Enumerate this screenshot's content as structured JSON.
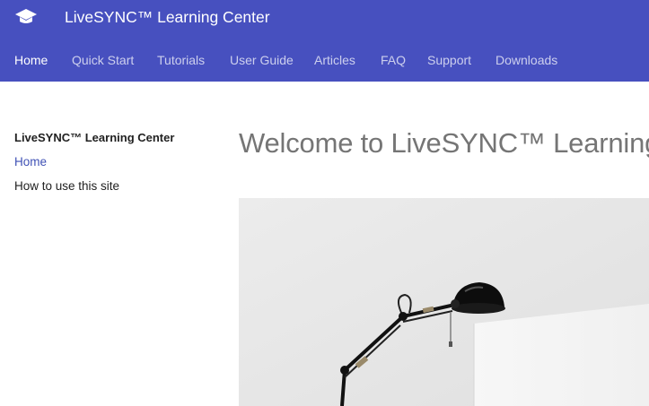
{
  "header": {
    "title": "LiveSYNC™ Learning Center",
    "logo_icon": "graduation-cap-icon",
    "background": "#4750bf"
  },
  "nav": {
    "tabs": [
      {
        "label": "Home",
        "active": true
      },
      {
        "label": "Quick Start",
        "active": false
      },
      {
        "label": "Tutorials",
        "active": false
      },
      {
        "label": "User Guide",
        "active": false
      },
      {
        "label": "Articles",
        "active": false
      },
      {
        "label": "FAQ",
        "active": false
      },
      {
        "label": "Support",
        "active": false
      },
      {
        "label": "Downloads",
        "active": false
      }
    ]
  },
  "sidebar": {
    "title": "LiveSYNC™ Learning Center",
    "items": [
      {
        "label": "Home",
        "active": true
      },
      {
        "label": "How to use this site",
        "active": false
      }
    ]
  },
  "main": {
    "title": "Welcome to LiveSYNC™ Learning",
    "hero_image": "desk-lamp-photo"
  },
  "colors": {
    "accent": "#3f51b5",
    "header": "#4750bf"
  }
}
